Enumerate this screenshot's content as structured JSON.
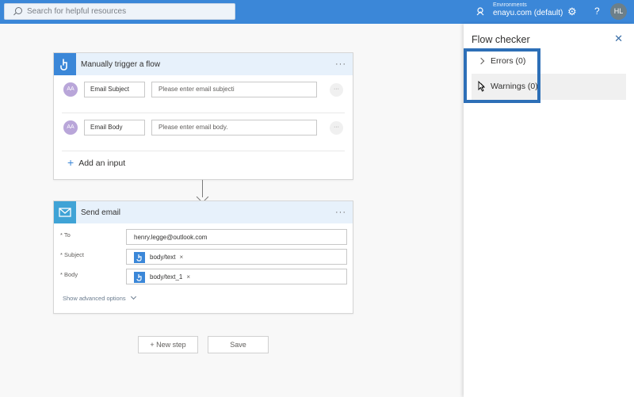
{
  "topbar": {
    "search_placeholder": "Search for helpful resources",
    "env_label": "Environments",
    "env_value": "enayu.com (default)",
    "user_initials": "HL"
  },
  "trigger": {
    "title": "Manually trigger a flow",
    "more": "···",
    "inputs": [
      {
        "avatar": "AA",
        "name": "Email Subject",
        "placeholder": "Please enter email subjecti",
        "more": "···"
      },
      {
        "avatar": "AA",
        "name": "Email Body",
        "placeholder": "Please enter email body.",
        "more": "···"
      }
    ],
    "add_input": "Add an input"
  },
  "send_email": {
    "title": "Send email",
    "more": "···",
    "fields": [
      {
        "label": "* To",
        "value": "henry.legge@outlook.com"
      },
      {
        "label": "* Subject",
        "token": "body/text",
        "remove": "×"
      },
      {
        "label": "* Body",
        "token": "body/text_1",
        "remove": "×"
      }
    ],
    "advanced": "Show advanced options"
  },
  "actions": {
    "new_step": "+ New step",
    "save": "Save"
  },
  "panel": {
    "title": "Flow checker",
    "errors": "Errors (0)",
    "warnings": "Warnings (0)"
  },
  "colors": {
    "topbar": "#3b87d8",
    "highlight": "#2d6fb7",
    "card_header": "#e7f1fb"
  }
}
